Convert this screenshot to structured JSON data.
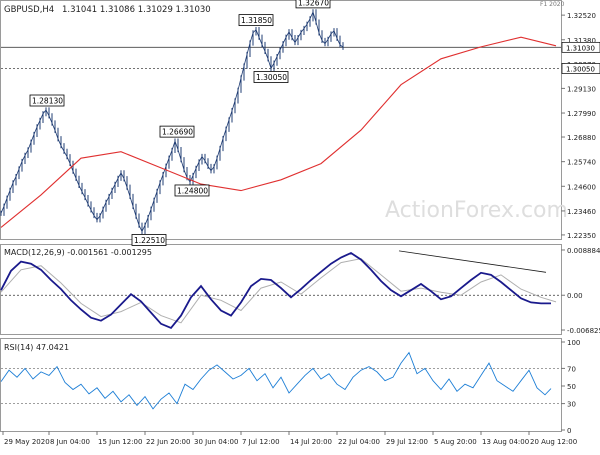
{
  "chart_data": {
    "type": "line",
    "symbol": "GBPUSD,H4",
    "header_ohlc": "1.31041 1.31086 1.31029 1.31030",
    "price_panel": {
      "series": [
        {
          "name": "price",
          "color": "#1f3c73",
          "x": [
            0,
            3,
            6,
            9,
            12,
            15,
            18,
            21,
            24,
            27,
            30,
            33,
            36,
            39,
            42,
            45,
            48,
            51,
            54,
            57,
            60,
            63,
            66,
            69,
            72,
            75,
            78,
            81,
            84,
            87,
            90,
            93,
            96,
            99,
            102,
            105,
            108,
            111,
            114,
            117,
            120,
            123,
            126,
            129,
            132,
            135,
            138,
            141,
            144,
            147,
            150,
            153,
            156,
            159,
            162,
            165,
            168,
            171,
            174,
            177,
            180,
            183,
            186,
            189,
            192,
            195,
            198,
            201,
            204,
            207,
            210,
            213,
            216,
            219,
            222,
            225,
            228,
            231,
            234,
            237,
            240,
            243,
            246,
            249,
            252,
            255,
            258,
            261,
            264,
            267,
            270,
            273,
            276,
            279,
            282,
            285,
            288,
            291,
            294,
            297,
            300,
            303,
            306,
            309,
            312,
            315,
            318,
            321,
            324,
            327,
            330,
            333,
            336,
            339,
            342,
            345,
            348,
            351,
            354,
            357,
            360,
            363,
            366,
            369,
            372,
            375,
            378,
            381,
            384,
            387,
            390,
            393,
            396,
            399,
            402,
            405,
            408,
            411,
            414,
            417,
            420,
            423,
            426,
            429,
            432,
            435,
            438,
            441,
            444,
            447,
            450,
            453,
            456,
            459,
            462,
            465,
            468,
            471,
            474,
            477,
            480,
            483,
            486,
            489,
            492,
            495,
            498,
            501,
            504,
            507,
            510,
            513,
            516,
            519,
            522,
            525,
            528,
            531,
            534,
            537,
            540,
            543,
            546,
            549,
            552,
            555
          ],
          "values": [
            1.2335,
            1.2368,
            1.2405,
            1.2441,
            1.2476,
            1.2505,
            1.254,
            1.2575,
            1.2603,
            1.2628,
            1.2664,
            1.27,
            1.2735,
            1.2765,
            1.2796,
            1.2813,
            1.2786,
            1.2753,
            1.2719,
            1.268,
            1.2648,
            1.2622,
            1.2597,
            1.2566,
            1.253,
            1.2497,
            1.2464,
            1.2435,
            1.2408,
            1.2378,
            1.2351,
            1.2325,
            1.2305,
            1.2323,
            1.2354,
            1.2386,
            1.2413,
            1.2441,
            1.2469,
            1.2497,
            1.2522,
            1.2495,
            1.2456,
            1.2413,
            1.2367,
            1.2322,
            1.228,
            1.2251,
            1.228,
            1.2315,
            1.2354,
            1.2395,
            1.2436,
            1.2476,
            1.2514,
            1.2553,
            1.259,
            1.2626,
            1.2669,
            1.263,
            1.2583,
            1.2537,
            1.25,
            1.248,
            1.251,
            1.2543,
            1.2573,
            1.2598,
            1.2578,
            1.2552,
            1.2532,
            1.255,
            1.259,
            1.2635,
            1.2681,
            1.2724,
            1.2767,
            1.281,
            1.2855,
            1.2904,
            1.2961,
            1.3016,
            1.307,
            1.3123,
            1.317,
            1.3185,
            1.315,
            1.3116,
            1.3084,
            1.305,
            1.3005,
            1.303,
            1.306,
            1.309,
            1.312,
            1.315,
            1.3175,
            1.3148,
            1.3125,
            1.3148,
            1.3172,
            1.319,
            1.321,
            1.3235,
            1.3267,
            1.322,
            1.317,
            1.3135,
            1.312,
            1.314,
            1.3165,
            1.318,
            1.3145,
            1.3115,
            1.3103
          ],
          "x_step_note": ""
        },
        {
          "name": "sma",
          "color": "#e03030",
          "x": [
            0,
            40,
            80,
            120,
            160,
            200,
            240,
            280,
            320,
            360,
            400,
            440,
            480,
            520,
            555
          ],
          "values": [
            1.227,
            1.242,
            1.259,
            1.262,
            1.2545,
            1.247,
            1.244,
            1.249,
            1.2565,
            1.272,
            1.293,
            1.305,
            1.3105,
            1.315,
            1.311
          ]
        }
      ],
      "ylim": [
        1.223,
        1.3285
      ],
      "y_ticks": [
        "1.32520",
        "1.31380",
        "1.30270",
        "1.29130",
        "1.27990",
        "1.26880",
        "1.25740",
        "1.24600",
        "1.23460",
        "1.22350"
      ],
      "y_tick_values": [
        1.3252,
        1.3138,
        1.3027,
        1.2913,
        1.2799,
        1.2688,
        1.2574,
        1.246,
        1.2346,
        1.2235
      ],
      "hlines": [
        {
          "value": 1.3103,
          "label": "1.31030",
          "style": "solid"
        },
        {
          "value": 1.3005,
          "label": "1.30050",
          "style": "dashed"
        }
      ],
      "annotations": [
        {
          "x": 46,
          "value": 1.2813,
          "label": "1.28130",
          "pos": "above"
        },
        {
          "x": 148,
          "value": 1.2251,
          "label": "1.22510",
          "pos": "below"
        },
        {
          "x": 176,
          "value": 1.2669,
          "label": "1.26690",
          "pos": "above"
        },
        {
          "x": 191,
          "value": 1.248,
          "label": "1.24800",
          "pos": "below"
        },
        {
          "x": 255,
          "value": 1.3185,
          "label": "1.31850",
          "pos": "above"
        },
        {
          "x": 270,
          "value": 1.3005,
          "label": "1.30050",
          "pos": "below"
        },
        {
          "x": 312,
          "value": 1.3267,
          "label": "1.32670",
          "pos": "above"
        }
      ],
      "watermark": "ActionForex.com"
    },
    "macd_panel": {
      "label": "MACD(12,26,9) -0.001561 -0.001295",
      "ylim": [
        -0.00682,
        0.00888
      ],
      "y_ticks": [
        "0.008884",
        "0.00",
        "-0.006825"
      ],
      "y_tick_values": [
        0.008884,
        0.0,
        -0.006825
      ],
      "series": [
        {
          "name": "macd",
          "color": "#1a1a8c",
          "x": [
            0,
            10,
            20,
            30,
            40,
            50,
            60,
            70,
            80,
            90,
            100,
            110,
            120,
            130,
            140,
            150,
            160,
            170,
            180,
            190,
            200,
            210,
            220,
            230,
            240,
            250,
            260,
            270,
            280,
            290,
            300,
            310,
            320,
            330,
            340,
            350,
            360,
            370,
            380,
            390,
            400,
            410,
            420,
            430,
            440,
            450,
            460,
            470,
            480,
            490,
            500,
            510,
            520,
            530,
            540,
            550
          ],
          "values": [
            0.001,
            0.0048,
            0.0066,
            0.0062,
            0.005,
            0.003,
            0.0012,
            -0.001,
            -0.0028,
            -0.0044,
            -0.005,
            -0.0038,
            -0.0018,
            0.0002,
            -0.0012,
            -0.0034,
            -0.0056,
            -0.0064,
            -0.004,
            -0.0004,
            0.0018,
            -0.0008,
            -0.003,
            -0.004,
            -0.0014,
            0.0018,
            0.0032,
            0.003,
            0.0014,
            -0.0004,
            0.0012,
            0.003,
            0.0046,
            0.0062,
            0.0074,
            0.0083,
            0.007,
            0.005,
            0.0028,
            0.001,
            -0.0002,
            0.001,
            0.0022,
            0.0008,
            -0.0008,
            -0.0002,
            0.0014,
            0.003,
            0.0044,
            0.004,
            0.0026,
            0.001,
            -0.0006,
            -0.0014,
            -0.0016,
            -0.0016
          ]
        },
        {
          "name": "signal",
          "color": "#b0b0b0",
          "x": [
            0,
            20,
            40,
            60,
            80,
            100,
            120,
            140,
            160,
            180,
            200,
            220,
            240,
            260,
            280,
            300,
            320,
            340,
            360,
            380,
            400,
            420,
            440,
            460,
            480,
            500,
            520,
            540,
            555
          ],
          "values": [
            0.0006,
            0.005,
            0.0058,
            0.0024,
            -0.0016,
            -0.0042,
            -0.0032,
            -0.0014,
            -0.004,
            -0.0054,
            0.0,
            -0.001,
            -0.003,
            0.0014,
            0.0026,
            0.0002,
            0.0034,
            0.0064,
            0.0072,
            0.004,
            0.0008,
            0.0014,
            0.0006,
            0.0,
            0.0026,
            0.004,
            0.0012,
            -0.0004,
            -0.0013
          ]
        },
        {
          "name": "trendline",
          "color": "#1a1a1a",
          "x": [
            398,
            545
          ],
          "values": [
            0.0087,
            0.0045
          ]
        }
      ],
      "zero_line": 0.0
    },
    "rsi_panel": {
      "label": "RSI(14) 47.0421",
      "ylim": [
        0,
        100
      ],
      "y_ticks": [
        "100",
        "70",
        "50",
        "30",
        "0"
      ],
      "y_tick_values": [
        100,
        70,
        50,
        30,
        0
      ],
      "levels": [
        70,
        30
      ],
      "series": [
        {
          "name": "rsi",
          "color": "#1e7fd6",
          "x": [
            0,
            8,
            16,
            24,
            32,
            40,
            48,
            56,
            64,
            72,
            80,
            88,
            96,
            104,
            112,
            120,
            128,
            136,
            144,
            152,
            160,
            168,
            176,
            184,
            192,
            200,
            208,
            216,
            224,
            232,
            240,
            248,
            256,
            264,
            272,
            280,
            288,
            296,
            304,
            312,
            320,
            328,
            336,
            344,
            352,
            360,
            368,
            376,
            384,
            392,
            400,
            408,
            416,
            424,
            432,
            440,
            448,
            456,
            464,
            472,
            480,
            488,
            496,
            504,
            512,
            520,
            528,
            536,
            544,
            550
          ],
          "values": [
            55,
            68,
            60,
            70,
            58,
            66,
            62,
            72,
            54,
            46,
            52,
            41,
            48,
            36,
            44,
            32,
            40,
            28,
            38,
            24,
            35,
            42,
            30,
            52,
            46,
            58,
            68,
            74,
            66,
            58,
            62,
            70,
            56,
            64,
            48,
            60,
            42,
            52,
            62,
            70,
            58,
            64,
            52,
            46,
            60,
            68,
            72,
            66,
            56,
            60,
            76,
            88,
            64,
            70,
            56,
            46,
            58,
            44,
            52,
            48,
            62,
            76,
            56,
            50,
            44,
            56,
            68,
            48,
            40,
            47
          ]
        }
      ]
    },
    "x_axis": {
      "labels": [
        "29 May 2020",
        "8 Jun 04:00",
        "15 Jun 12:00",
        "22 Jun 20:00",
        "30 Jun 04:00",
        "7 Jul 12:00",
        "14 Jul 20:00",
        "22 Jul 04:00",
        "29 Jul 12:00",
        "5 Aug 20:00",
        "13 Aug 04:00",
        "20 Aug 12:00"
      ],
      "label_x": [
        2,
        48,
        96,
        144,
        192,
        240,
        288,
        336,
        384,
        432,
        480,
        528
      ]
    }
  },
  "ui": {
    "corner_label": "F1 2020"
  }
}
